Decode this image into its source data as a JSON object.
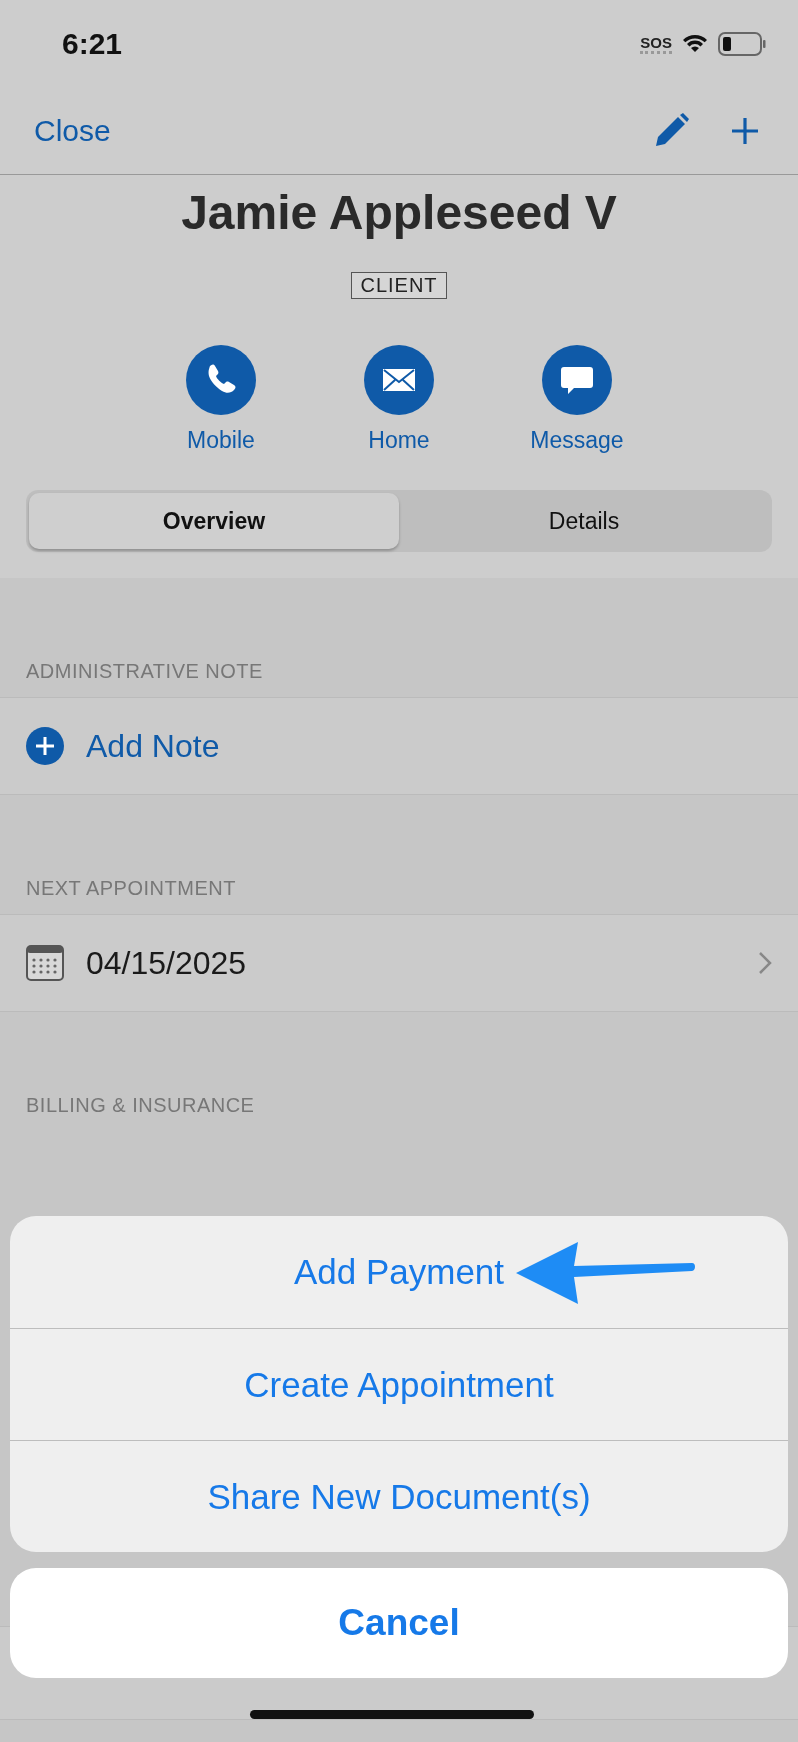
{
  "status_bar": {
    "time": "6:21",
    "sos": "SOS"
  },
  "nav": {
    "close": "Close"
  },
  "contact": {
    "name": "Jamie Appleseed V",
    "badge": "CLIENT"
  },
  "actions": [
    {
      "kind": "phone",
      "label": "Mobile"
    },
    {
      "kind": "mail",
      "label": "Home"
    },
    {
      "kind": "message",
      "label": "Message"
    }
  ],
  "tabs": [
    {
      "label": "Overview",
      "selected": true
    },
    {
      "label": "Details",
      "selected": false
    }
  ],
  "sections": [
    {
      "header": "ADMINISTRATIVE NOTE",
      "row": {
        "kind": "add",
        "text": "Add Note"
      }
    },
    {
      "header": "NEXT APPOINTMENT",
      "row": {
        "kind": "date",
        "text": "04/15/2025"
      }
    },
    {
      "header": "BILLING & INSURANCE"
    }
  ],
  "action_sheet": {
    "options": [
      "Add Payment",
      "Create Appointment",
      "Share New Document(s)"
    ],
    "cancel": "Cancel"
  }
}
